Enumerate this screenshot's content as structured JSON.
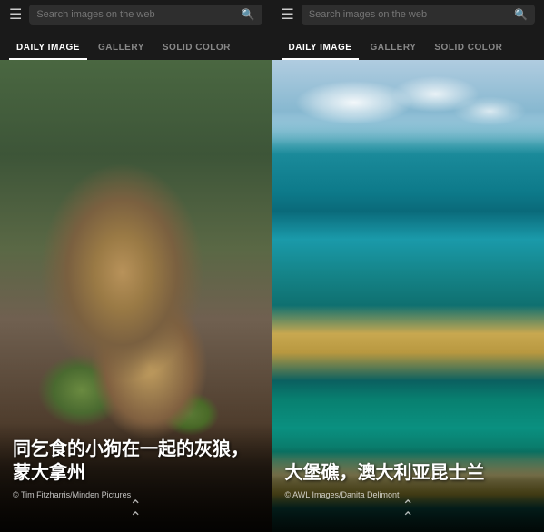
{
  "panels": [
    {
      "id": "left",
      "header": {
        "search_placeholder": "Search images on the web"
      },
      "tabs": [
        {
          "id": "daily-image",
          "label": "DAILY IMAGE",
          "active": true
        },
        {
          "id": "gallery",
          "label": "GALLERY",
          "active": false
        },
        {
          "id": "solid-color",
          "label": "SOLID COLOR",
          "active": false
        }
      ],
      "image": {
        "type": "wolf",
        "caption_title": "同乞食的小狗在一起的灰狼，蒙大拿州",
        "credit": "© Tim Fitzharris/Minden Pictures"
      }
    },
    {
      "id": "right",
      "header": {
        "search_placeholder": "Search images on the web"
      },
      "tabs": [
        {
          "id": "daily-image",
          "label": "DAILY IMAGE",
          "active": true
        },
        {
          "id": "gallery",
          "label": "GALLERY",
          "active": false
        },
        {
          "id": "solid-color",
          "label": "SOLID COLOR",
          "active": false
        }
      ],
      "image": {
        "type": "reef",
        "caption_title": "大堡礁，澳大利亚昆士兰",
        "credit": "© AWL Images/Danita Delimont"
      }
    }
  ],
  "icons": {
    "hamburger": "☰",
    "search": "🔍",
    "chevron_up": "⌃"
  }
}
